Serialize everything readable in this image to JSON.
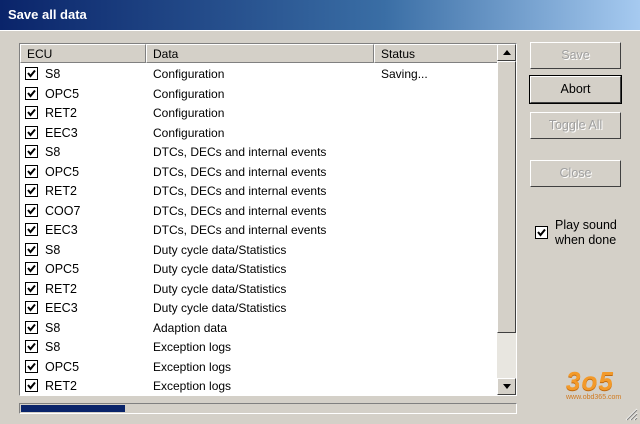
{
  "window": {
    "title": "Save all data"
  },
  "table": {
    "columns": [
      {
        "label": "ECU",
        "width": 126
      },
      {
        "label": "Data",
        "width": 228
      },
      {
        "label": "Status",
        "width": 124
      }
    ],
    "rows": [
      {
        "checked": true,
        "ecu": "S8",
        "data": "Configuration",
        "status": "Saving..."
      },
      {
        "checked": true,
        "ecu": "OPC5",
        "data": "Configuration",
        "status": ""
      },
      {
        "checked": true,
        "ecu": "RET2",
        "data": "Configuration",
        "status": ""
      },
      {
        "checked": true,
        "ecu": "EEC3",
        "data": "Configuration",
        "status": ""
      },
      {
        "checked": true,
        "ecu": "S8",
        "data": "DTCs, DECs and internal events",
        "status": ""
      },
      {
        "checked": true,
        "ecu": "OPC5",
        "data": "DTCs, DECs and internal events",
        "status": ""
      },
      {
        "checked": true,
        "ecu": "RET2",
        "data": "DTCs, DECs and internal events",
        "status": ""
      },
      {
        "checked": true,
        "ecu": "COO7",
        "data": "DTCs, DECs and internal events",
        "status": ""
      },
      {
        "checked": true,
        "ecu": "EEC3",
        "data": "DTCs, DECs and internal events",
        "status": ""
      },
      {
        "checked": true,
        "ecu": "S8",
        "data": "Duty cycle data/Statistics",
        "status": ""
      },
      {
        "checked": true,
        "ecu": "OPC5",
        "data": "Duty cycle data/Statistics",
        "status": ""
      },
      {
        "checked": true,
        "ecu": "RET2",
        "data": "Duty cycle data/Statistics",
        "status": ""
      },
      {
        "checked": true,
        "ecu": "EEC3",
        "data": "Duty cycle data/Statistics",
        "status": ""
      },
      {
        "checked": true,
        "ecu": "S8",
        "data": "Adaption data",
        "status": ""
      },
      {
        "checked": true,
        "ecu": "S8",
        "data": "Exception logs",
        "status": ""
      },
      {
        "checked": true,
        "ecu": "OPC5",
        "data": "Exception logs",
        "status": ""
      },
      {
        "checked": true,
        "ecu": "RET2",
        "data": "Exception logs",
        "status": ""
      }
    ]
  },
  "buttons": {
    "save": {
      "label": "Save",
      "enabled": false
    },
    "abort": {
      "label": "Abort",
      "enabled": true
    },
    "toggle_all": {
      "label": "Toggle All",
      "enabled": false
    },
    "close": {
      "label": "Close",
      "enabled": false
    }
  },
  "options": {
    "play_sound_label": "Play sound when done",
    "play_sound_checked": true
  },
  "progress": {
    "value": 0.21
  },
  "watermark": {
    "logo_text": "3o5",
    "url": "www.obd365.com"
  },
  "colors": {
    "title_gradient_start": "#0a246a",
    "progress_fill": "#0a246a",
    "dialog_bg": "#d4d0c8"
  }
}
